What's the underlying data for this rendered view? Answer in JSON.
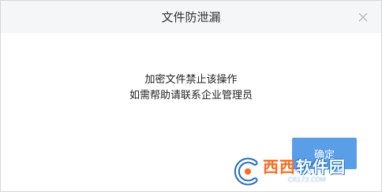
{
  "dialog": {
    "title": "文件防泄漏",
    "message_line1": "加密文件禁止该操作",
    "message_line2": "如需帮助请联系企业管理员",
    "ok_label": "确定"
  },
  "watermark": {
    "brand_part1": "西西",
    "brand_part2": "软件园",
    "url": "CR173.COM"
  },
  "colors": {
    "titlebar_bg": "#f5f6f8",
    "ok_button_bg": "#5b9ee8",
    "watermark_orange": "#ff6a1a",
    "watermark_blue": "#1e6cc0"
  },
  "icons": {
    "close": "close-icon",
    "watermark_logo": "cr-logo-icon"
  }
}
